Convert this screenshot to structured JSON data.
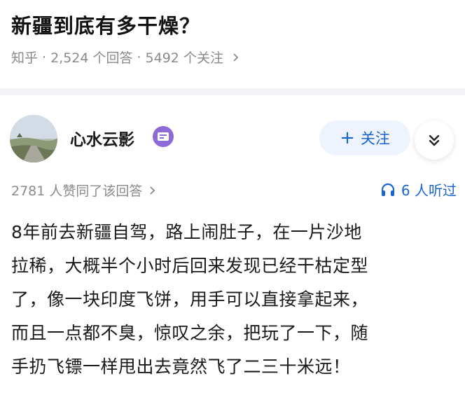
{
  "question": {
    "title": "新疆到底有多干燥？",
    "source": "知乎",
    "answer_count": "2,524 个回答",
    "follower_count": "5492 个关注",
    "separator": "·"
  },
  "author": {
    "name": "心水云影",
    "badge_icon": "certified-badge-icon",
    "badge_color": "#8e6ad8",
    "follow_label": "关注",
    "follow_plus": "+",
    "more_icon": "double-chevron-down-icon"
  },
  "stats": {
    "upvote_text": "2781 人赞同了该回答",
    "listen_text": "6 人听过",
    "listen_icon": "headphones-icon"
  },
  "answer": {
    "lines": [
      "8年前去新疆自驾，路上闹肚子，在一片沙地",
      "拉稀，大概半个小时后回来发现已经干枯定型",
      "了，像一块印度飞饼，用手可以直接拿起来，",
      "而且一点都不臭，惊叹之余，把玩了一下，随",
      "手扔飞镖一样甩出去竟然飞了二三十米远！"
    ]
  },
  "colors": {
    "accent": "#1966d2",
    "muted_text": "#8a8a8a",
    "follow_bg": "#eef3fd"
  }
}
